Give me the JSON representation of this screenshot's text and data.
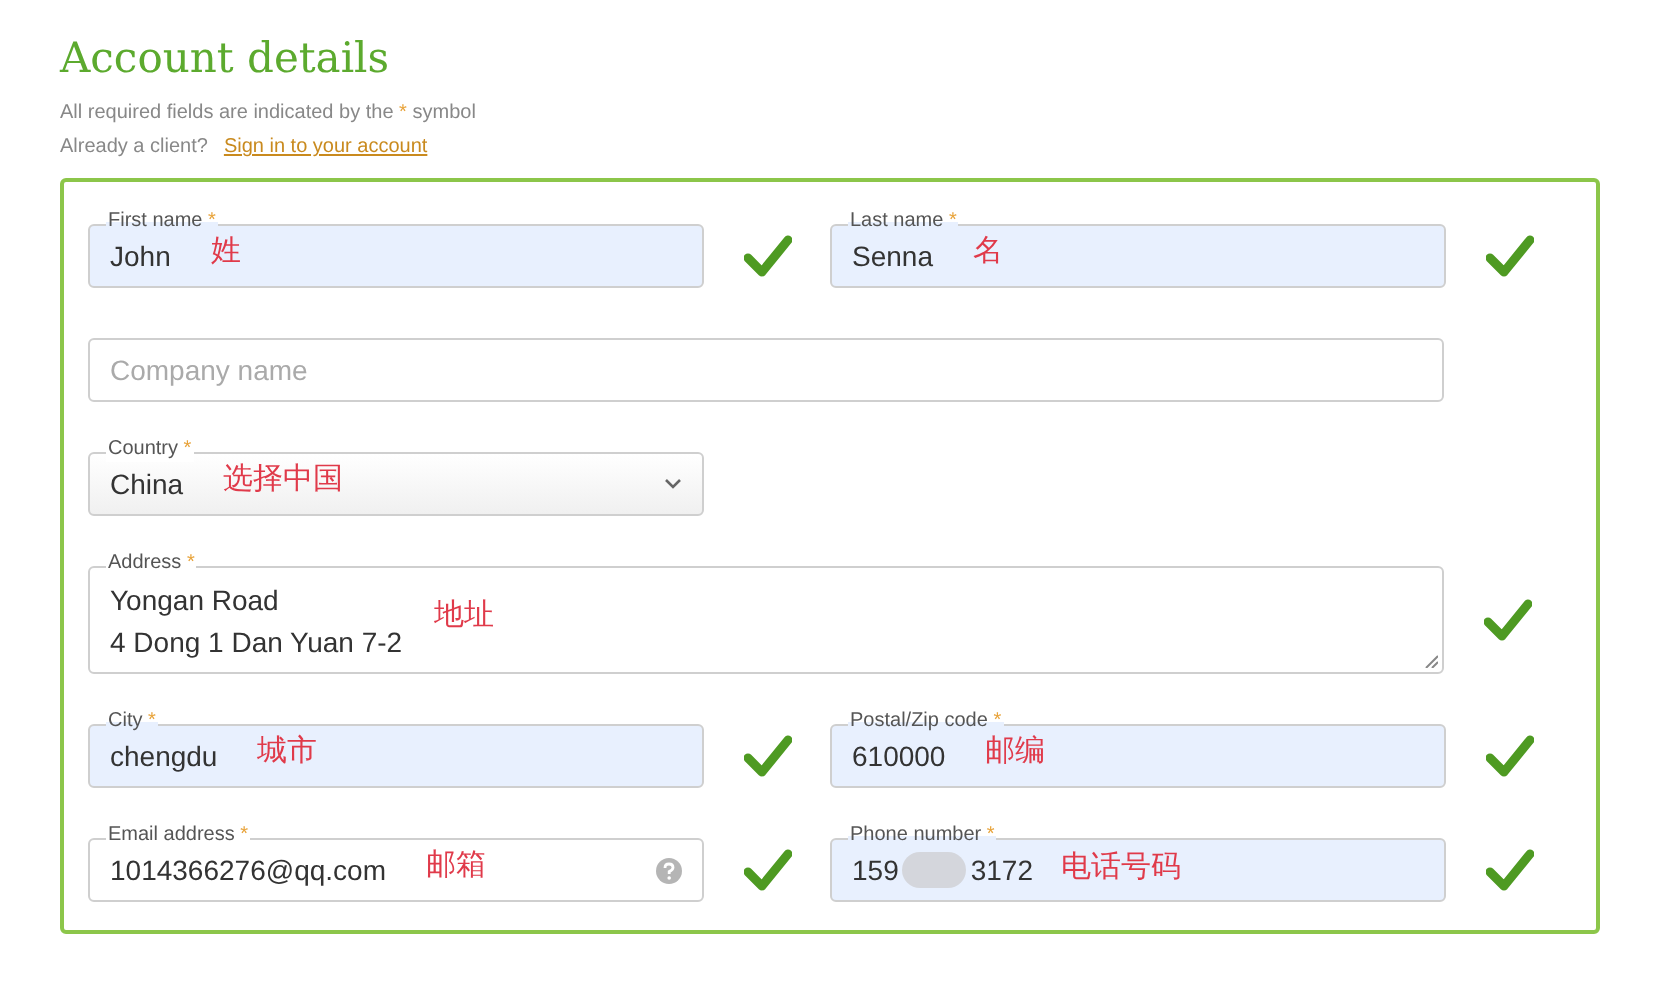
{
  "title": "Account details",
  "required_note": {
    "before": "All required fields are indicated by the",
    "mark": "*",
    "after": "symbol"
  },
  "signin": {
    "prompt": "Already a client?",
    "link": "Sign in to your account"
  },
  "rows": [
    [
      {
        "kind": "text",
        "label": "First name",
        "required_mark": "*",
        "value": "John",
        "autofilled": true,
        "valid": true,
        "annotation": "姓"
      },
      {
        "kind": "text",
        "label": "Last name",
        "required_mark": "*",
        "value": "Senna",
        "autofilled": true,
        "valid": true,
        "annotation": "名"
      }
    ],
    [
      {
        "kind": "text",
        "placeholder": "Company name",
        "autofilled": false,
        "valid": false
      }
    ],
    [
      {
        "kind": "select",
        "label": "Country",
        "required_mark": "*",
        "value": "China",
        "autofilled": false,
        "valid": false,
        "annotation": "选择中国"
      }
    ],
    [
      {
        "kind": "textarea",
        "label": "Address",
        "required_mark": "*",
        "lines": [
          "Yongan Road",
          "4 Dong 1 Dan Yuan 7-2"
        ],
        "autofilled": false,
        "valid": true,
        "annotation": "地址"
      }
    ],
    [
      {
        "kind": "text",
        "label": "City",
        "required_mark": "*",
        "value": "chengdu",
        "autofilled": true,
        "valid": true,
        "annotation": "城市"
      },
      {
        "kind": "text",
        "label": "Postal/Zip code",
        "required_mark": "*",
        "value": "610000",
        "autofilled": true,
        "valid": true,
        "annotation": "邮编"
      }
    ],
    [
      {
        "kind": "email",
        "label": "Email address",
        "required_mark": "*",
        "value": "1014366276@qq.com",
        "autofilled": false,
        "valid": true,
        "annotation": "邮箱"
      },
      {
        "kind": "phone",
        "label": "Phone number",
        "required_mark": "*",
        "value": "159",
        "value_after_blur": "3172",
        "autofilled": true,
        "valid": true,
        "annotation": "电话号码"
      }
    ]
  ]
}
